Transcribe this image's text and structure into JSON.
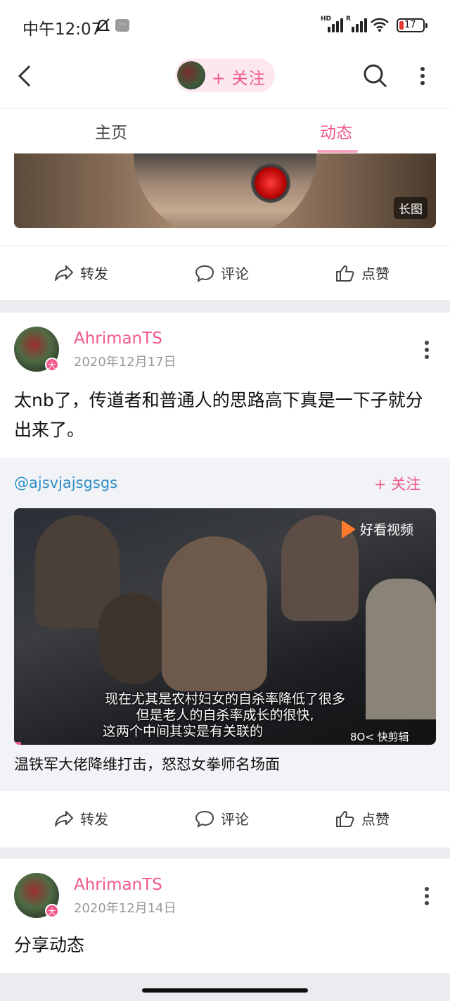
{
  "status_bar": {
    "time": "中午12:07",
    "signal1_tag": "HD",
    "signal2_tag": "R",
    "battery": "17"
  },
  "nav": {
    "follow_label": "+ 关注"
  },
  "tabs": [
    {
      "label": "主页"
    },
    {
      "label": "动态"
    }
  ],
  "top_image": {
    "badge": "长图"
  },
  "actions": {
    "share": "转发",
    "comment": "评论",
    "like": "点赞"
  },
  "posts": [
    {
      "user": "AhrimanTS",
      "date": "2020年12月17日",
      "level": "大",
      "text": "太nb了，传道者和普通人的思路高下真是一下子就分出来了。",
      "repost": {
        "mention": "@ajsvjajsgsgs",
        "follow": "+ 关注",
        "video_brand": "好看视频",
        "subtitle_lines": [
          "现在尤其是农村妇女的自杀率降低了很多",
          "但是老人的自杀率成长的很快,",
          "这两个中间其实是有关联的"
        ],
        "watermark": "8O< 快剪辑",
        "title": "温铁军大佬降维打击，怒怼女拳师名场面"
      }
    },
    {
      "user": "AhrimanTS",
      "date": "2020年12月14日",
      "level": "大",
      "text": "分享动态"
    }
  ]
}
